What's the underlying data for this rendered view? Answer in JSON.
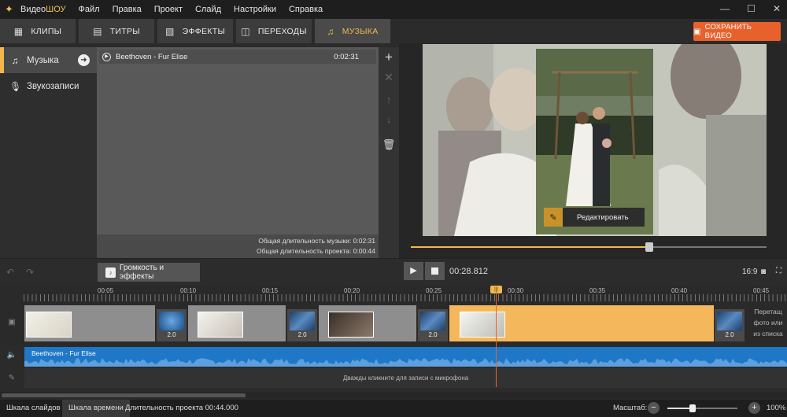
{
  "titlebar": {
    "app_name_prefix": "Видео",
    "app_name_suffix": "ШОУ",
    "menu": [
      "Файл",
      "Правка",
      "Проект",
      "Слайд",
      "Настройки",
      "Справка"
    ],
    "window_buttons": [
      "—",
      "☐",
      "✕"
    ]
  },
  "tabs": [
    {
      "label": "КЛИПЫ",
      "icon": "film-icon"
    },
    {
      "label": "ТИТРЫ",
      "icon": "text-icon"
    },
    {
      "label": "ЭФФЕКТЫ",
      "icon": "effects-icon"
    },
    {
      "label": "ПЕРЕХОДЫ",
      "icon": "transition-icon"
    },
    {
      "label": "МУЗЫКА",
      "icon": "music-note-icon",
      "active": true
    }
  ],
  "save_button": {
    "label": "СОХРАНИТЬ ВИДЕО",
    "color": "#e8612c"
  },
  "left_nav": [
    {
      "label": "Музыка",
      "active": true
    },
    {
      "label": "Звукозаписи",
      "active": false
    }
  ],
  "music": {
    "tracks": [
      {
        "name": "Beethoven - Fur Elise",
        "duration": "0:02:31"
      }
    ],
    "total_music_duration": "Общая длительность музыки: 0:02:31",
    "total_project_duration": "Общая длительность проекта: 0:00:44"
  },
  "preview": {
    "edit_button": "Редактировать",
    "progress": 0.67
  },
  "toolbar": {
    "volume_effects": "Громкость и эффекты",
    "timecode": "00:28.812",
    "aspect": "16:9"
  },
  "timeline": {
    "labels": [
      "00:05",
      "00:10",
      "00:15",
      "00:20",
      "00:25",
      "00:30",
      "00:35",
      "00:40",
      "00:45"
    ],
    "transitions": [
      "2.0",
      "2.0",
      "2.0",
      "2.0",
      "2.0"
    ],
    "hint": "Перетащите фото или из списка",
    "hint_lines": [
      "Перетащ",
      "фото или",
      "из списка"
    ],
    "audio_track": "Beethoven - Fur Elise",
    "mic_hint": "Дважды кликните для записи с микрофона"
  },
  "statusbar": {
    "tab_slides": "Шкала слайдов",
    "tab_timeline": "Шкала времени",
    "project_duration": "Длительность проекта 00:44.000",
    "zoom_label": "Масштаб:",
    "zoom_value": "100%",
    "zoom_level": 0.36
  },
  "colors": {
    "accent": "#f2b84b",
    "audio": "#1f77c7",
    "save": "#e8612c"
  }
}
